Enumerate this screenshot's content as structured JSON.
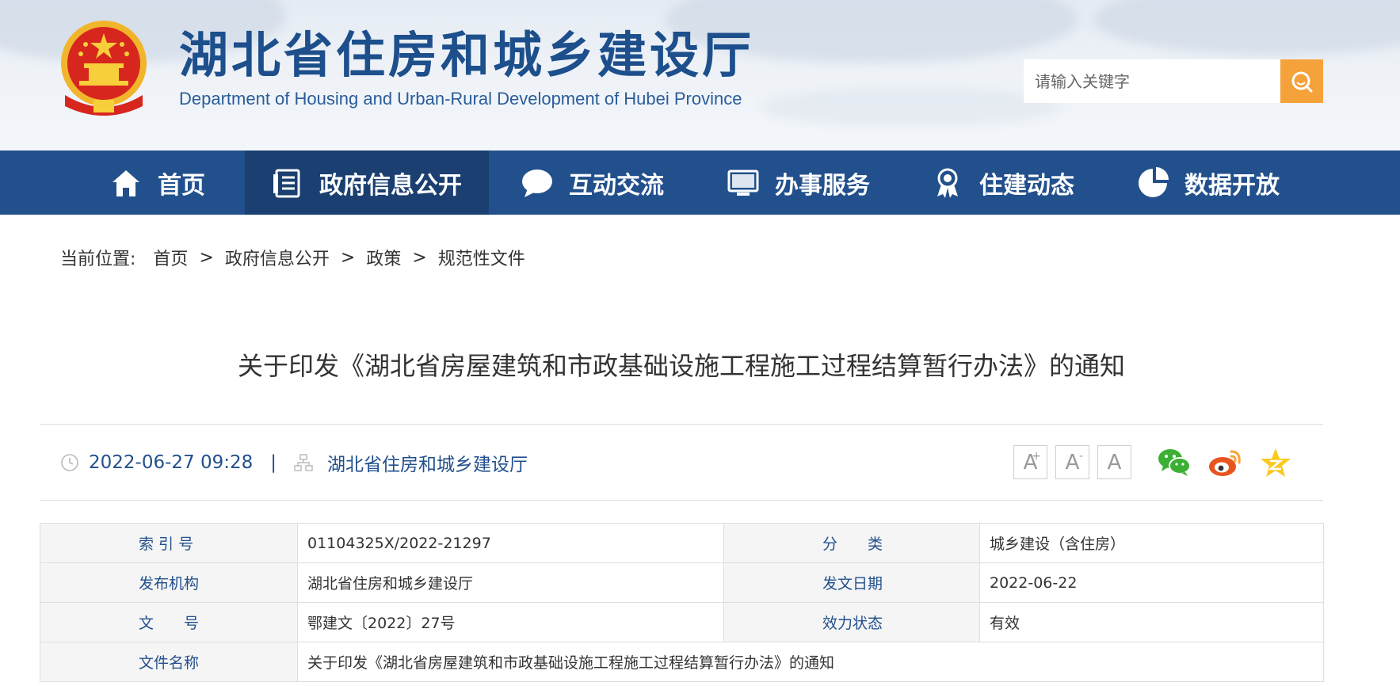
{
  "header": {
    "title": "湖北省住房和城乡建设厅",
    "subtitle": "Department of Housing and Urban-Rural Development of Hubei Province",
    "search_placeholder": "请输入关键字"
  },
  "nav": {
    "items": [
      {
        "label": "首页",
        "icon": "home-icon"
      },
      {
        "label": "政府信息公开",
        "icon": "document-list-icon"
      },
      {
        "label": "互动交流",
        "icon": "chat-bubble-icon"
      },
      {
        "label": "办事服务",
        "icon": "monitor-icon"
      },
      {
        "label": "住建动态",
        "icon": "award-ribbon-icon"
      },
      {
        "label": "数据开放",
        "icon": "pie-chart-icon"
      }
    ],
    "active_index": 1
  },
  "breadcrumb": {
    "lead": "当前位置:",
    "items": [
      "首页",
      "政府信息公开",
      "政策",
      "规范性文件"
    ],
    "separator": ">"
  },
  "article": {
    "title": "关于印发《湖北省房屋建筑和市政基础设施工程施工过程结算暂行办法》的通知",
    "datetime": "2022-06-27 09:28",
    "divider": "|",
    "source": "湖北省住房和城乡建设厅"
  },
  "font_size": {
    "increase": "A",
    "increase_mark": "+",
    "decrease": "A",
    "decrease_mark": "-",
    "reset": "A"
  },
  "share": [
    "wechat-icon",
    "weibo-icon",
    "qzone-icon"
  ],
  "info_table": {
    "index_label": "索 引 号",
    "index_value": "01104325X/2022-21297",
    "category_label": "分　　类",
    "category_value": "城乡建设（含住房）",
    "issuer_label": "发布机构",
    "issuer_value": "湖北省住房和城乡建设厅",
    "date_label": "发文日期",
    "date_value": "2022-06-22",
    "docno_label": "文　　号",
    "docno_value": "鄂建文〔2022〕27号",
    "status_label": "效力状态",
    "status_value": "有效",
    "filename_label": "文件名称",
    "filename_value": "关于印发《湖北省房屋建筑和市政基础设施工程施工过程结算暂行办法》的通知"
  },
  "colors": {
    "nav_bg": "#22508c",
    "nav_active": "#1a3f70",
    "accent": "#f5a23a",
    "title_blue": "#1d4f8c"
  }
}
